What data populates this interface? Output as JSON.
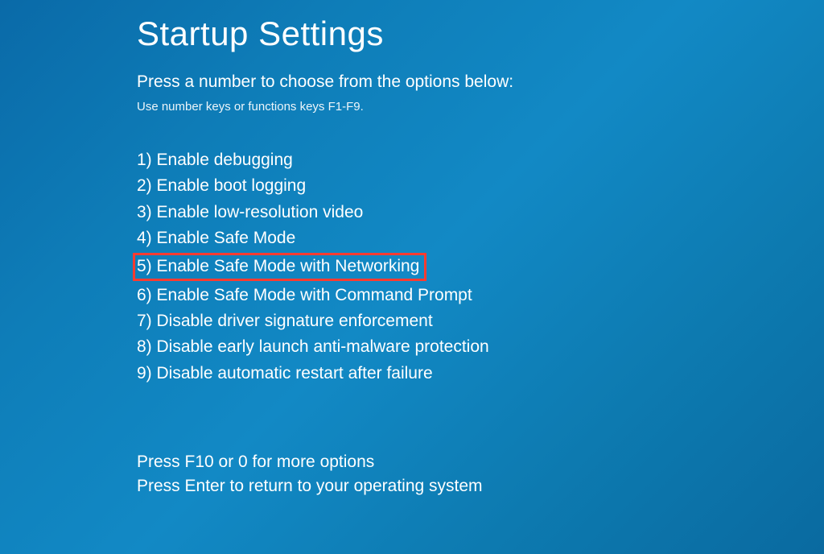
{
  "title": "Startup Settings",
  "instruction": "Press a number to choose from the options below:",
  "sub_instruction": "Use number keys or functions keys F1-F9.",
  "options": [
    "1) Enable debugging",
    "2) Enable boot logging",
    "3) Enable low-resolution video",
    "4) Enable Safe Mode",
    "5) Enable Safe Mode with Networking",
    "6) Enable Safe Mode with Command Prompt",
    "7) Disable driver signature enforcement",
    "8) Disable early launch anti-malware protection",
    "9) Disable automatic restart after failure"
  ],
  "highlighted_index": 4,
  "footer": {
    "more_options": "Press F10 or 0 for more options",
    "return": "Press Enter to return to your operating system"
  }
}
